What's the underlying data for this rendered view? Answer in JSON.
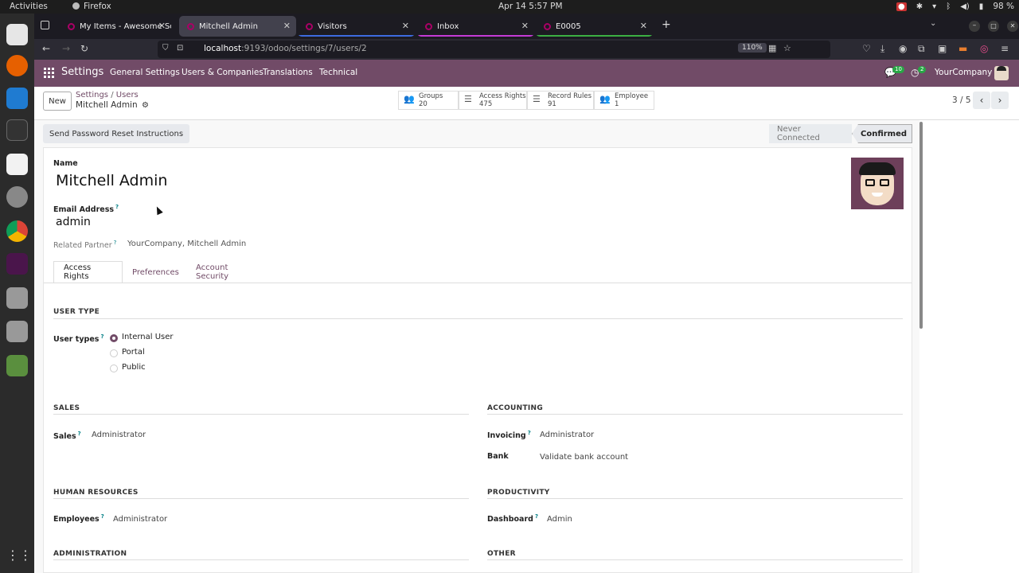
{
  "system": {
    "activities": "Activities",
    "app": "Firefox",
    "clock": "Apr 14  5:57 PM",
    "battery": "98 %"
  },
  "tabs": [
    {
      "title": "My Items - Awesome Scre"
    },
    {
      "title": "Mitchell Admin"
    },
    {
      "title": "Visitors"
    },
    {
      "title": "Inbox"
    },
    {
      "title": "E0005"
    }
  ],
  "browser": {
    "url_host": "localhost",
    "url_rest": ":9193/odoo/settings/7/users/2",
    "zoom": "110%"
  },
  "odoo_nav": {
    "brand": "Settings",
    "menus": [
      "General Settings",
      "Users & Companies",
      "Translations",
      "Technical"
    ],
    "chat_badge": "10",
    "activity_badge": "2",
    "company": "YourCompany"
  },
  "control_panel": {
    "new_label": "New",
    "breadcrumb": [
      "Settings",
      "Users"
    ],
    "record_name": "Mitchell Admin",
    "smart_buttons": [
      {
        "label": "Groups",
        "value": "20"
      },
      {
        "label": "Access Rights",
        "value": "475"
      },
      {
        "label": "Record Rules",
        "value": "91"
      },
      {
        "label": "Employee",
        "value": "1"
      }
    ],
    "pager": "3 / 5"
  },
  "statusbar": {
    "reset_label": "Send Password Reset Instructions",
    "stages": [
      "Never Connected",
      "Confirmed"
    ]
  },
  "form": {
    "name_label": "Name",
    "name_value": "Mitchell Admin",
    "email_label": "Email Address",
    "email_value": "admin",
    "partner_label": "Related Partner",
    "partner_value": "YourCompany, Mitchell Admin",
    "tabs": [
      "Access Rights",
      "Preferences",
      "Account Security"
    ],
    "user_type_title": "USER TYPE",
    "user_types_label": "User types",
    "user_types": [
      "Internal User",
      "Portal",
      "Public"
    ],
    "sections": {
      "sales": "SALES",
      "accounting": "ACCOUNTING",
      "hr": "HUMAN RESOURCES",
      "productivity": "PRODUCTIVITY",
      "administration": "ADMINISTRATION",
      "other": "OTHER"
    },
    "fields": {
      "sales_label": "Sales",
      "sales_value": "Administrator",
      "invoicing_label": "Invoicing",
      "invoicing_value": "Administrator",
      "bank_label": "Bank",
      "bank_value": "Validate bank account",
      "employees_label": "Employees",
      "employees_value": "Administrator",
      "dashboard_label": "Dashboard",
      "dashboard_value": "Admin"
    }
  }
}
